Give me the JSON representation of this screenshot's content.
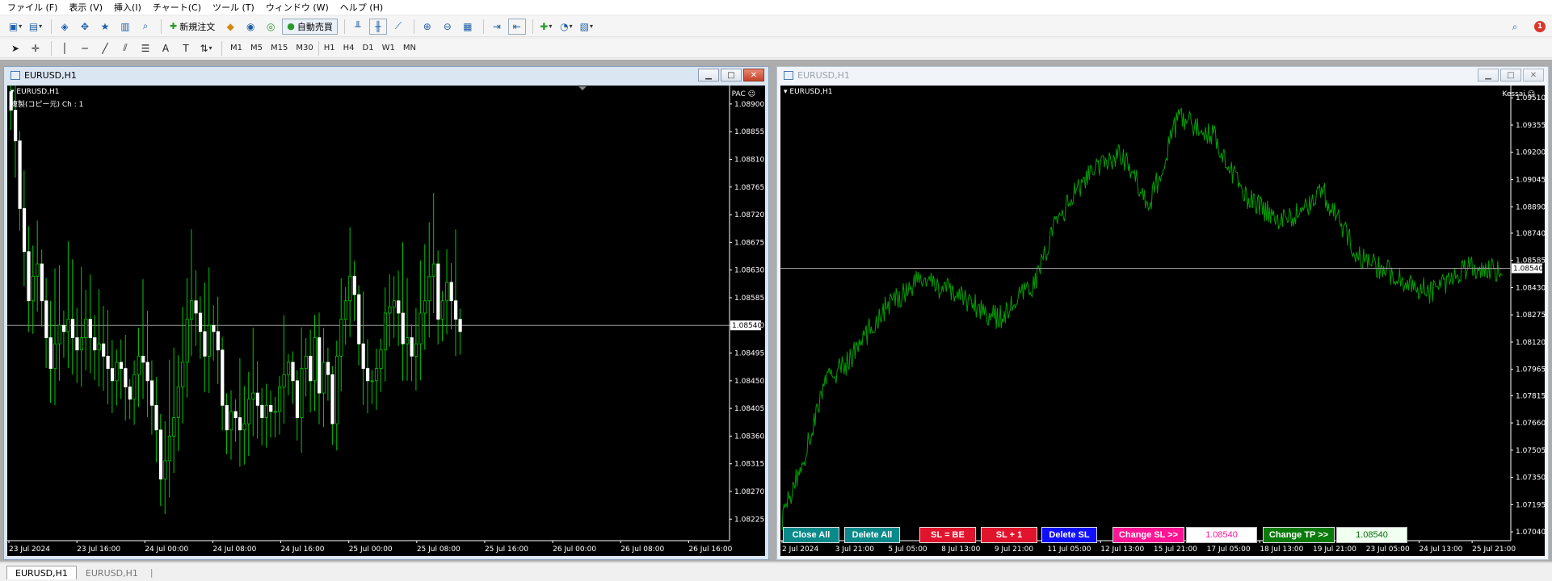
{
  "menu": [
    "ファイル (F)",
    "表示 (V)",
    "挿入(I)",
    "チャート(C)",
    "ツール (T)",
    "ウィンドウ (W)",
    "ヘルプ (H)"
  ],
  "toolbar": {
    "new_order_label": "新規注文",
    "autotrade_label": "自動売買",
    "notification_count": "1",
    "timeframes": [
      "M1",
      "M5",
      "M15",
      "M30",
      "H1",
      "H4",
      "D1",
      "W1",
      "MN"
    ]
  },
  "left_window": {
    "title": "EURUSD,H1",
    "symbol_label": "EURUSD,H1",
    "indicator_label": "複製(コピー元) Ch : 1",
    "ea_label": "PAC",
    "current_price": "1.08540",
    "price_ticks": [
      "1.08900",
      "1.08855",
      "1.08810",
      "1.08765",
      "1.08720",
      "1.08675",
      "1.08630",
      "1.08585",
      "1.08540",
      "1.08495",
      "1.08450",
      "1.08405",
      "1.08360",
      "1.08315",
      "1.08270",
      "1.08225"
    ],
    "time_ticks": [
      "23 Jul 2024",
      "23 Jul 16:00",
      "24 Jul 00:00",
      "24 Jul 08:00",
      "24 Jul 16:00",
      "25 Jul 00:00",
      "25 Jul 08:00",
      "25 Jul 16:00",
      "26 Jul 00:00",
      "26 Jul 08:00",
      "26 Jul 16:00"
    ]
  },
  "right_window": {
    "title": "EURUSD,H1",
    "symbol_label": "EURUSD,H1",
    "ea_label": "Kessai",
    "current_price": "1.08540",
    "price_ticks": [
      "1.09510",
      "1.09355",
      "1.09200",
      "1.09045",
      "1.08890",
      "1.08740",
      "1.08585",
      "1.08430",
      "1.08275",
      "1.08120",
      "1.07965",
      "1.07815",
      "1.07660",
      "1.07505",
      "1.07350",
      "1.07195",
      "1.07040"
    ],
    "time_ticks": [
      "2 Jul 2024",
      "3 Jul 21:00",
      "5 Jul 05:00",
      "8 Jul 13:00",
      "9 Jul 21:00",
      "11 Jul 05:00",
      "12 Jul 13:00",
      "15 Jul 21:00",
      "17 Jul 05:00",
      "18 Jul 13:00",
      "19 Jul 21:00",
      "23 Jul 05:00",
      "24 Jul 13:00",
      "25 Jul 21:00"
    ],
    "buttons": {
      "close_all": "Close All",
      "delete_all": "Delete All",
      "sl_be": "SL = BE",
      "sl_plus": "SL + 1",
      "delete_sl": "Delete SL",
      "change_sl": "Change SL >>",
      "sl_value": "1.08540",
      "change_tp": "Change TP >>",
      "tp_value": "1.08540"
    }
  },
  "tabs": [
    "EURUSD,H1",
    "EURUSD,H1"
  ],
  "colors": {
    "chart_bg": "#000000",
    "bull_candle": "#ffffff",
    "wick_green": "#00c800",
    "line_chart": "#00a000",
    "close_all_btn": "#0a8a8a",
    "sl_be_btn": "#e0142c",
    "delete_sl_btn": "#1010ff",
    "change_sl_btn": "#ff1493",
    "change_tp_btn": "#0a7a0a"
  },
  "chart_data": [
    {
      "type": "candlestick",
      "title": "EURUSD,H1",
      "ylim": [
        1.0819,
        1.0893
      ],
      "categories_start": "23 Jul 2024",
      "closes": [
        1.0889,
        1.0884,
        1.0873,
        1.0866,
        1.0858,
        1.0862,
        1.0864,
        1.0858,
        1.0852,
        1.0847,
        1.0851,
        1.0854,
        1.0853,
        1.0855,
        1.0852,
        1.085,
        1.0852,
        1.0855,
        1.0852,
        1.085,
        1.0851,
        1.0849,
        1.0847,
        1.0845,
        1.0848,
        1.0847,
        1.0844,
        1.0842,
        1.0846,
        1.0849,
        1.0848,
        1.0845,
        1.0841,
        1.0837,
        1.0829,
        1.0832,
        1.0836,
        1.0839,
        1.0844,
        1.0848,
        1.0855,
        1.0858,
        1.0856,
        1.0853,
        1.0849,
        1.0854,
        1.0853,
        1.085,
        1.0841,
        1.0837,
        1.084,
        1.0839,
        1.0837,
        1.0838,
        1.0842,
        1.0843,
        1.0841,
        1.0839,
        1.0841,
        1.084,
        1.084,
        1.0844,
        1.0846,
        1.0848,
        1.0845,
        1.0839,
        1.0847,
        1.0849,
        1.0845,
        1.0852,
        1.0843,
        1.0848,
        1.0846,
        1.0838,
        1.0849,
        1.0855,
        1.0858,
        1.0862,
        1.0859,
        1.0851,
        1.0847,
        1.0845,
        1.0845,
        1.0847,
        1.085,
        1.0856,
        1.0857,
        1.0858,
        1.0856,
        1.0851,
        1.0852,
        1.0849,
        1.0851,
        1.0856,
        1.0858,
        1.0862,
        1.0864,
        1.0855,
        1.0858,
        1.0861,
        1.0858,
        1.0855,
        1.0853
      ]
    },
    {
      "type": "line",
      "title": "EURUSD,H1",
      "ylim": [
        1.0699,
        1.0958
      ]
    }
  ]
}
